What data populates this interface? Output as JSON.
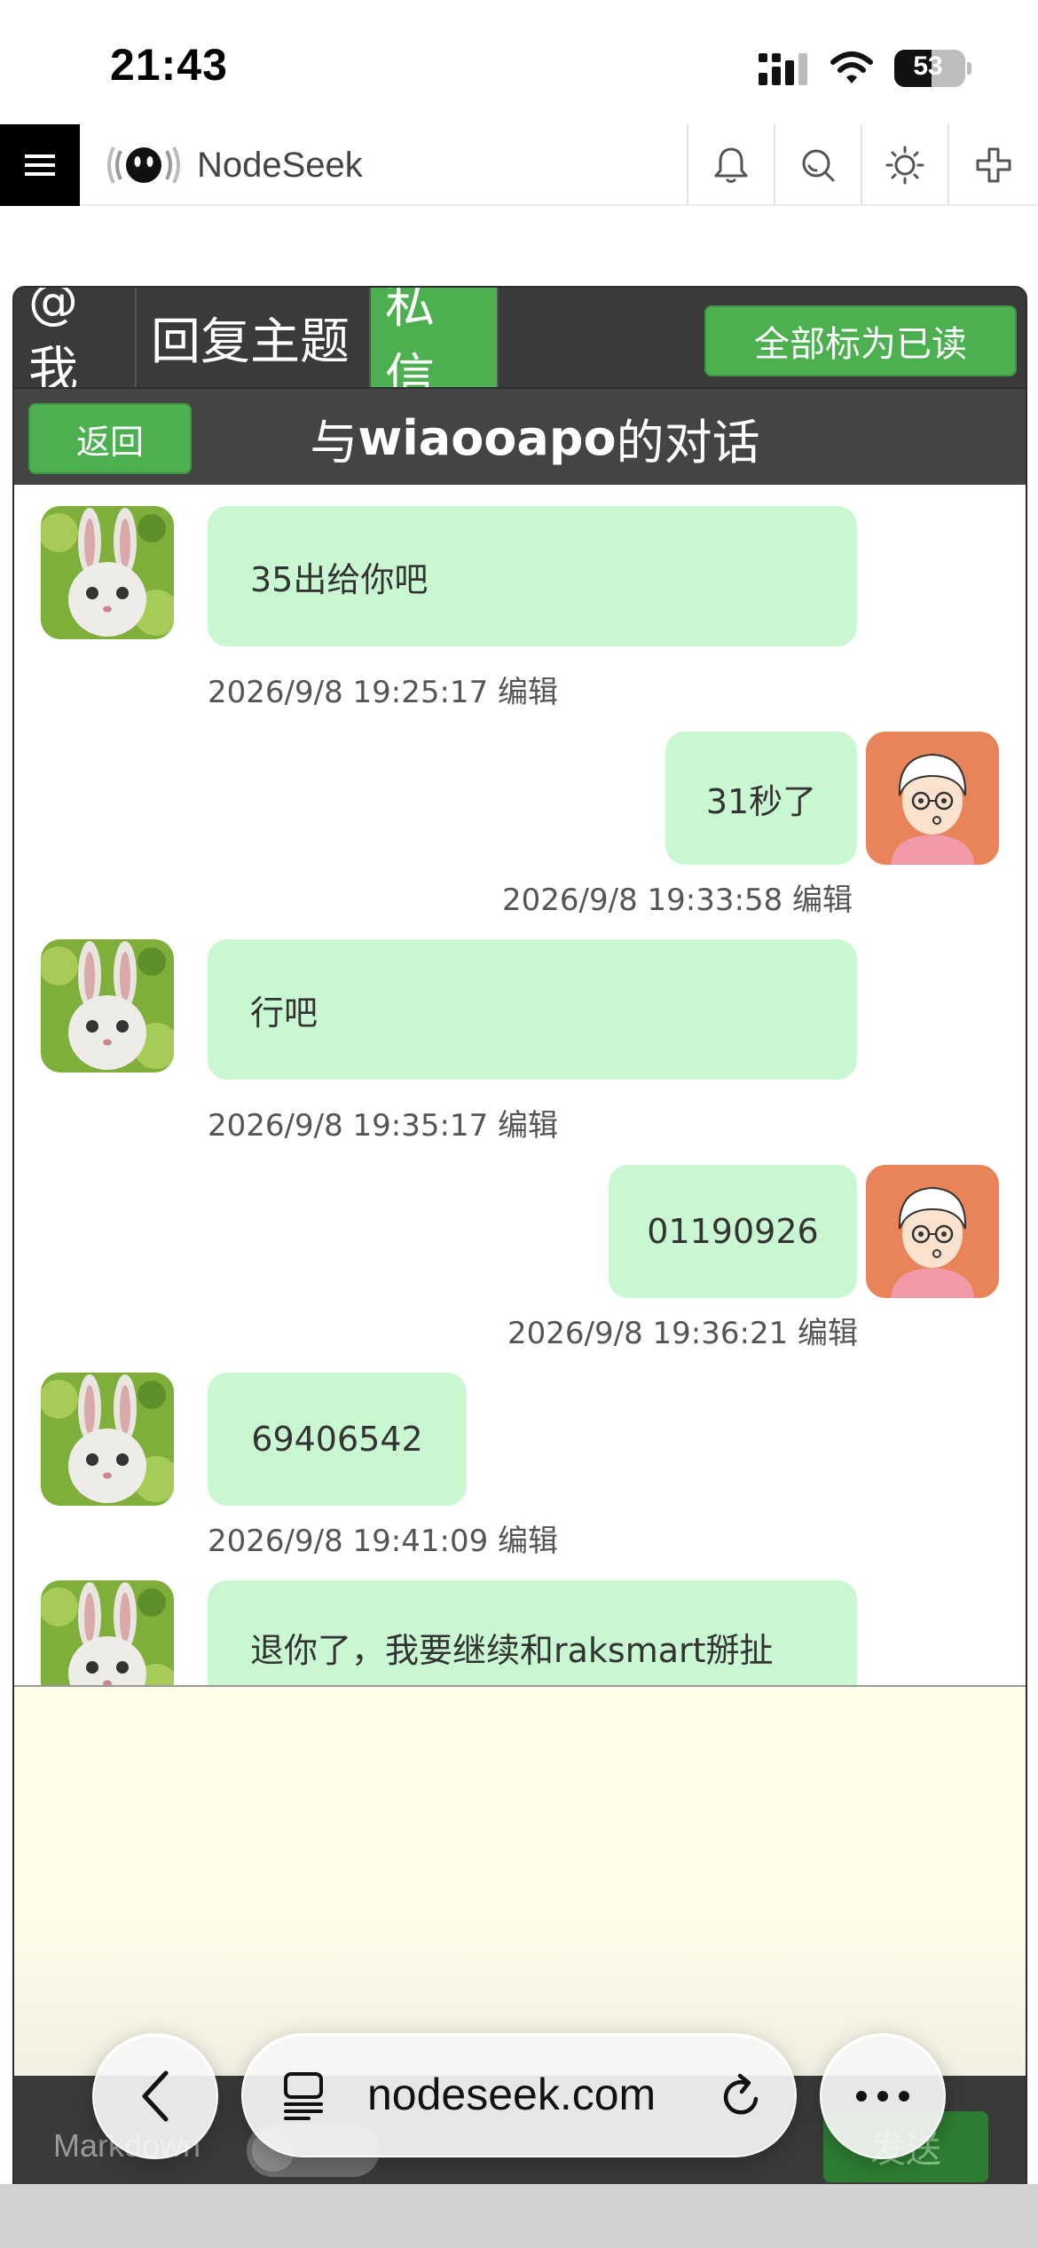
{
  "status_bar": {
    "time": "21:43",
    "battery": "53"
  },
  "site_header": {
    "brand": "NodeSeek"
  },
  "tabs": [
    {
      "label": "@我"
    },
    {
      "label": "回复主题"
    },
    {
      "label": "私信",
      "active": true
    }
  ],
  "mark_all_read": "全部标为已读",
  "conversation": {
    "back_label": "返回",
    "title_prefix": "与",
    "title_user": "wiaooapo",
    "title_suffix": "的对话"
  },
  "messages": [
    {
      "side": "left",
      "text": "35出给你吧",
      "time": "2026/9/8 19:25:17",
      "edit": "编辑"
    },
    {
      "side": "right",
      "text": "31秒了",
      "time": "2026/9/8 19:33:58",
      "edit": "编辑"
    },
    {
      "side": "left",
      "text": "行吧",
      "time": "2026/9/8 19:35:17",
      "edit": "编辑"
    },
    {
      "side": "right",
      "text": "01190926",
      "time": "2026/9/8 19:36:21",
      "edit": "编辑"
    },
    {
      "side": "left",
      "text": "69406542",
      "time": "2026/9/8 19:41:09",
      "edit": "编辑"
    },
    {
      "side": "left",
      "text": "退你了，我要继续和raksmart掰扯"
    }
  ],
  "composer": {
    "markdown_label": "Markdown",
    "send_label": "发送"
  },
  "browser": {
    "url": "nodeseek.com"
  },
  "colors": {
    "accent_green": "#4caf50",
    "bubble": "#c9f7d1",
    "panel_dark": "#3a3a3a"
  }
}
